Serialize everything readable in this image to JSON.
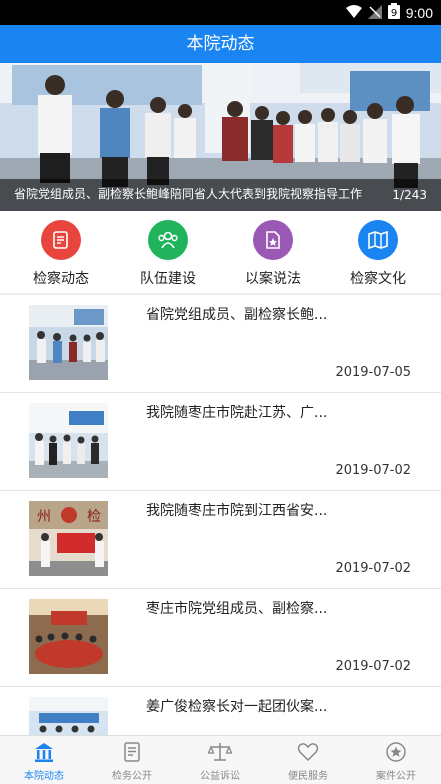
{
  "status_bar": {
    "time": "9:00"
  },
  "app_bar": {
    "title": "本院动态"
  },
  "banner": {
    "caption": "省院党组成员、副检察长鲍峰陪同省人大代表到我院视察指导工作",
    "counter": "1/243"
  },
  "categories": [
    {
      "label": "检察动态",
      "icon": "document-icon",
      "color": "#e8453c"
    },
    {
      "label": "队伍建设",
      "icon": "team-icon",
      "color": "#1fb35c"
    },
    {
      "label": "以案说法",
      "icon": "case-star-icon",
      "color": "#9b59b6"
    },
    {
      "label": "检察文化",
      "icon": "book-map-icon",
      "color": "#1a84f0"
    }
  ],
  "news": [
    {
      "title": "省院党组成员、副检察长鲍...",
      "date": "2019-07-05"
    },
    {
      "title": "我院随枣庄市院赴江苏、广...",
      "date": "2019-07-02"
    },
    {
      "title": "我院随枣庄市院到江西省安...",
      "date": "2019-07-02"
    },
    {
      "title": "枣庄市院党组成员、副检察...",
      "date": "2019-07-02"
    },
    {
      "title": "姜广俊检察长对一起团伙案...",
      "date": ""
    }
  ],
  "tabs": [
    {
      "label": "本院动态",
      "icon": "court-building-icon",
      "active": true
    },
    {
      "label": "检务公开",
      "icon": "file-list-icon",
      "active": false
    },
    {
      "label": "公益诉讼",
      "icon": "scales-icon",
      "active": false
    },
    {
      "label": "便民服务",
      "icon": "heart-icon",
      "active": false
    },
    {
      "label": "案件公开",
      "icon": "star-badge-icon",
      "active": false
    }
  ],
  "colors": {
    "primary": "#1a84f0",
    "status_bar": "#000000"
  }
}
